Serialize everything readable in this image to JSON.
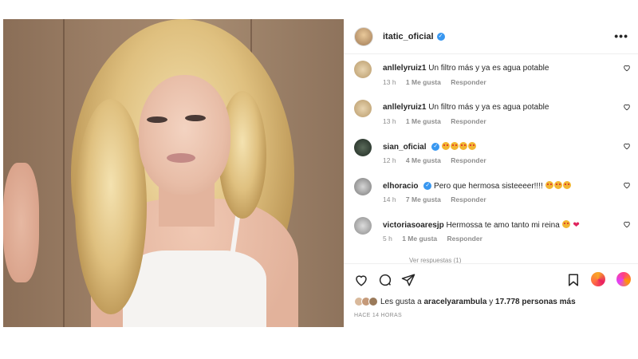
{
  "post": {
    "author": "itatic_oficial",
    "verified_icon": "verified-badge-icon",
    "more_icon": "more-options-icon",
    "more_label": "•••"
  },
  "comments": [
    {
      "user": "anllelyruiz1",
      "text": "Un filtro más y ya es agua potable",
      "time": "13 h",
      "likes": "1 Me gusta",
      "reply": "Responder",
      "verified": false
    },
    {
      "user": "anllelyruiz1",
      "text": "Un filtro más y ya es agua potable",
      "time": "13 h",
      "likes": "1 Me gusta",
      "reply": "Responder",
      "verified": false
    },
    {
      "user": "sian_oficial",
      "text": "",
      "time": "12 h",
      "likes": "4 Me gusta",
      "reply": "Responder",
      "verified": true,
      "emojis": 4
    },
    {
      "user": "elhoracio",
      "text": "Pero que hermosa sisteeeer!!!!",
      "time": "14 h",
      "likes": "7 Me gusta",
      "reply": "Responder",
      "verified": true,
      "emojis": 3
    },
    {
      "user": "victoriasoaresjp",
      "text": "Hermossa te amo tanto mi reina",
      "time": "5 h",
      "likes": "1 Me gusta",
      "reply": "Responder",
      "verified": false,
      "emojis": 1,
      "heart": "❤"
    }
  ],
  "view_replies": "Ver respuestas (1)",
  "actions": {
    "like_icon": "heart-icon",
    "comment_icon": "comment-icon",
    "share_icon": "share-icon",
    "save_icon": "bookmark-icon"
  },
  "likes": {
    "prefix": "Les gusta a",
    "user": "aracelyarambula",
    "middle": "y",
    "count": "17.778 personas más"
  },
  "timestamp": "HACE 14 HORAS",
  "colors": {
    "verified": "#3897f0",
    "muted": "#8e8e8e",
    "text": "#262626"
  }
}
